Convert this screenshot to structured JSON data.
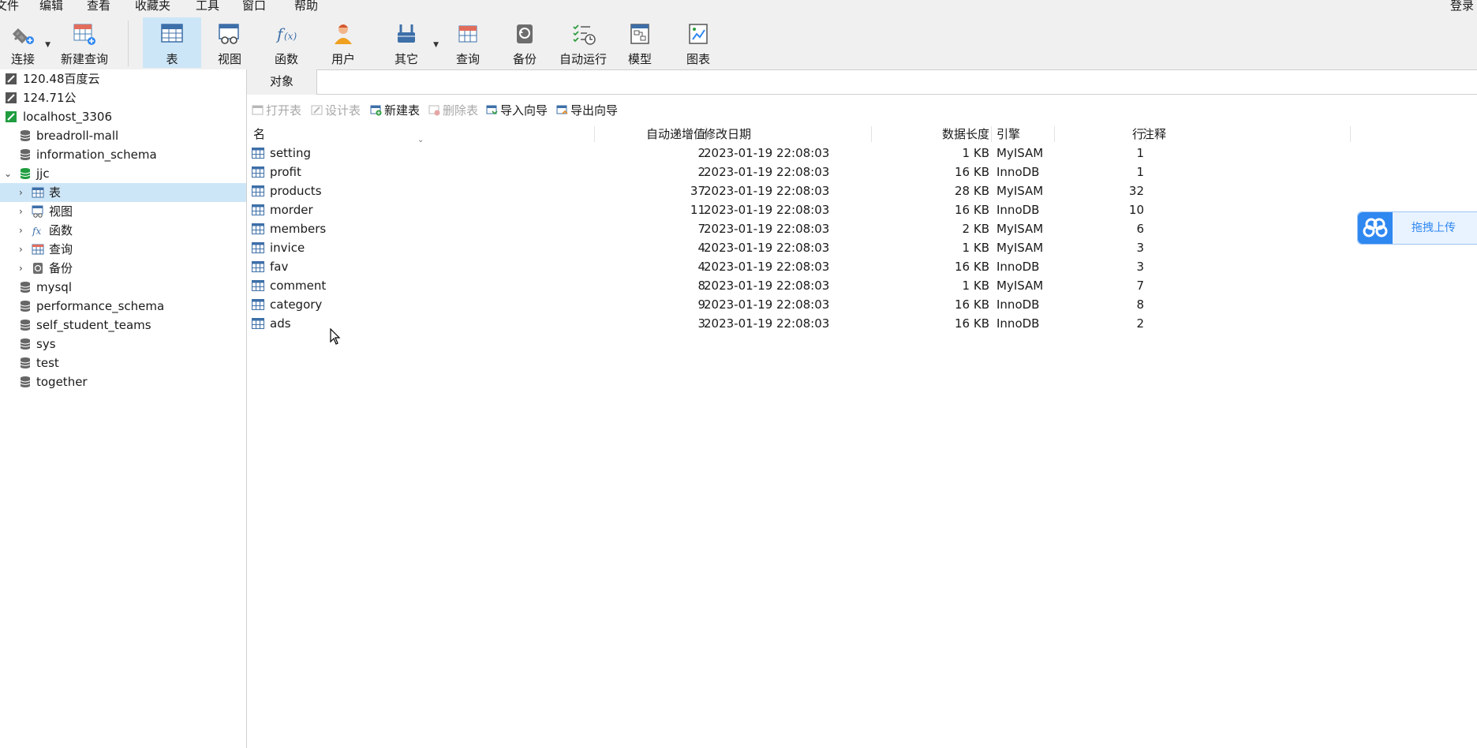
{
  "menu": [
    "文件",
    "编辑",
    "查看",
    "收藏夹",
    "工具",
    "窗口",
    "帮助"
  ],
  "login_label": "登录",
  "toolbar": {
    "connect": "连接",
    "new_query": "新建查询",
    "table": "表",
    "view": "视图",
    "function": "函数",
    "user": "用户",
    "other": "其它",
    "query": "查询",
    "backup": "备份",
    "autorun": "自动运行",
    "model": "模型",
    "chart": "图表"
  },
  "sidebar": {
    "connections": [
      {
        "label": "120.48百度云"
      },
      {
        "label": "124.71公"
      },
      {
        "label": "localhost_3306"
      }
    ],
    "databases_top": [
      "breadroll-mall",
      "information_schema"
    ],
    "open_db": "jjc",
    "open_db_children": [
      "表",
      "视图",
      "函数",
      "查询",
      "备份"
    ],
    "databases_bottom": [
      "mysql",
      "performance_schema",
      "self_student_teams",
      "sys",
      "test",
      "together"
    ]
  },
  "tab": {
    "objects": "对象"
  },
  "object_toolbar": {
    "open_table": "打开表",
    "design_table": "设计表",
    "new_table": "新建表",
    "delete_table": "删除表",
    "import_wizard": "导入向导",
    "export_wizard": "导出向导"
  },
  "table": {
    "columns": [
      "名",
      "自动递增值",
      "修改日期",
      "数据长度",
      "引擎",
      "行",
      "注释"
    ],
    "rows": [
      {
        "name": "setting",
        "auto": "2",
        "date": "2023-01-19 22:08:03",
        "size": "1 KB",
        "engine": "MyISAM",
        "rows": "1"
      },
      {
        "name": "profit",
        "auto": "2",
        "date": "2023-01-19 22:08:03",
        "size": "16 KB",
        "engine": "InnoDB",
        "rows": "1"
      },
      {
        "name": "products",
        "auto": "37",
        "date": "2023-01-19 22:08:03",
        "size": "28 KB",
        "engine": "MyISAM",
        "rows": "32"
      },
      {
        "name": "morder",
        "auto": "11",
        "date": "2023-01-19 22:08:03",
        "size": "16 KB",
        "engine": "InnoDB",
        "rows": "10"
      },
      {
        "name": "members",
        "auto": "7",
        "date": "2023-01-19 22:08:03",
        "size": "2 KB",
        "engine": "MyISAM",
        "rows": "6"
      },
      {
        "name": "invice",
        "auto": "4",
        "date": "2023-01-19 22:08:03",
        "size": "1 KB",
        "engine": "MyISAM",
        "rows": "3"
      },
      {
        "name": "fav",
        "auto": "4",
        "date": "2023-01-19 22:08:03",
        "size": "16 KB",
        "engine": "InnoDB",
        "rows": "3"
      },
      {
        "name": "comment",
        "auto": "8",
        "date": "2023-01-19 22:08:03",
        "size": "1 KB",
        "engine": "MyISAM",
        "rows": "7"
      },
      {
        "name": "category",
        "auto": "9",
        "date": "2023-01-19 22:08:03",
        "size": "16 KB",
        "engine": "InnoDB",
        "rows": "8"
      },
      {
        "name": "ads",
        "auto": "3",
        "date": "2023-01-19 22:08:03",
        "size": "16 KB",
        "engine": "InnoDB",
        "rows": "2"
      }
    ]
  },
  "upload_widget": {
    "label": "拖拽上传"
  },
  "colors": {
    "selection": "#cde6f7",
    "accent": "#2f87f0",
    "db_green": "#1f9d3f"
  }
}
